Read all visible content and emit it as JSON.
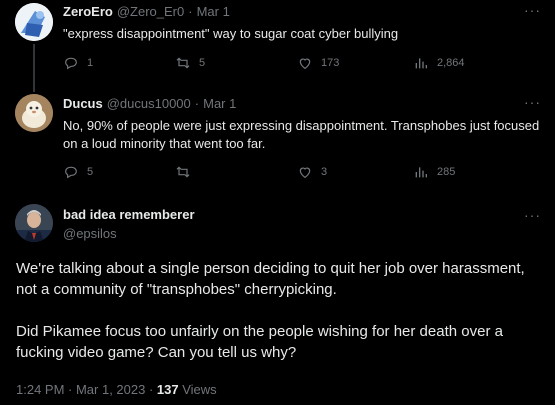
{
  "replies": [
    {
      "name": "ZeroEro",
      "handle": "@Zero_Er0",
      "date": "Mar 1",
      "text": "\"express disappointment\" way to sugar coat cyber bullying",
      "stats": {
        "replies": "1",
        "retweets": "5",
        "likes": "173",
        "views": "2,864"
      }
    },
    {
      "name": "Ducus",
      "handle": "@ducus10000",
      "date": "Mar 1",
      "text": "No, 90% of people were just expressing disappointment. Transphobes just focused on a loud minority that went too far.",
      "stats": {
        "replies": "5",
        "retweets": "",
        "likes": "3",
        "views": "285"
      }
    }
  ],
  "main": {
    "name": "bad idea rememberer",
    "handle": "@epsilos",
    "para1": "We're talking about a single person deciding to quit her job over harassment, not a community of \"transphobes\" cherrypicking.",
    "para2": "Did Pikamee focus too unfairly on the people wishing for her death over a fucking video game? Can you tell us why?",
    "time": "1:24 PM · Mar 1, 2023 · ",
    "views_count": "137",
    "views_label": " Views"
  },
  "ui": {
    "dot": "·",
    "more": "···"
  },
  "icons": [
    "reply-icon",
    "retweet-icon",
    "like-icon",
    "views-icon",
    "more-icon"
  ],
  "colors": {
    "background": "#000000",
    "text": "#e7e9ea",
    "muted": "#71767b",
    "thread_line": "#333639"
  }
}
